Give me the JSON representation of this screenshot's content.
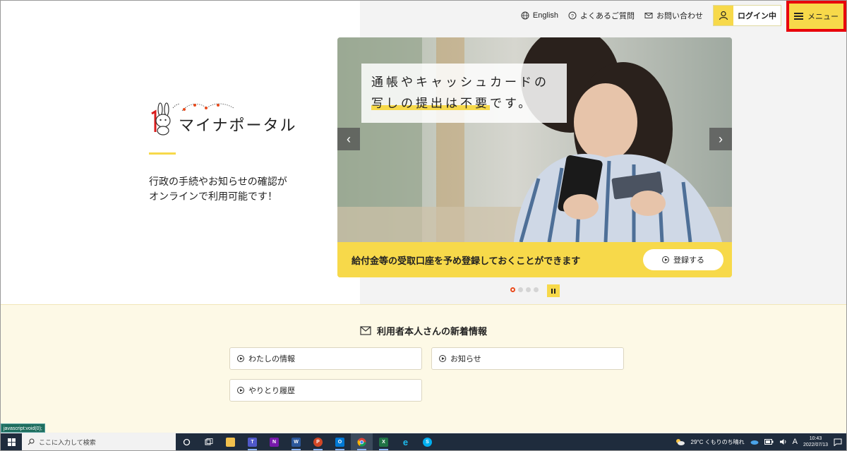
{
  "header": {
    "english": "English",
    "faq": "よくあるご質問",
    "contact": "お問い合わせ",
    "login": "ログイン中",
    "menu": "メニュー"
  },
  "brand": {
    "logo_text": "マイナポータル",
    "tagline_line1": "行政の手続やお知らせの確認が",
    "tagline_line2": "オンラインで利用可能です！"
  },
  "hero": {
    "caption_line1": "通帳やキャッシュカードの",
    "caption_line2_highlight": "写しの提出は不要",
    "caption_line2_rest": "です。",
    "bar_text": "給付金等の受取口座を予め登録しておくことができます",
    "register_label": "登録する",
    "prev": "‹",
    "next": "›",
    "slide_count": 4,
    "active_slide": 1
  },
  "news": {
    "title": "利用者本人さんの新着情報",
    "items": [
      {
        "label": "わたしの情報"
      },
      {
        "label": "お知らせ"
      },
      {
        "label": "やりとり履歴"
      }
    ]
  },
  "status_bar": {
    "text": "javascript:void(0);"
  },
  "taskbar": {
    "search_placeholder": "ここに入力して検索",
    "weather": "29°C くもりのち晴れ",
    "ime": "A",
    "time": "10:43",
    "date": "2022/07/13",
    "colors": {
      "teams": "#5059c9",
      "onenote": "#7719aa",
      "word": "#2b579a",
      "powerpoint": "#d24726",
      "outlook": "#0078d4",
      "excel": "#217346",
      "ie": "#1ebbee",
      "skype": "#00aff0"
    }
  },
  "colors": {
    "accent_yellow": "#f7d94a",
    "highlight_red": "#e8000b",
    "news_bg": "#fdf9e6"
  }
}
